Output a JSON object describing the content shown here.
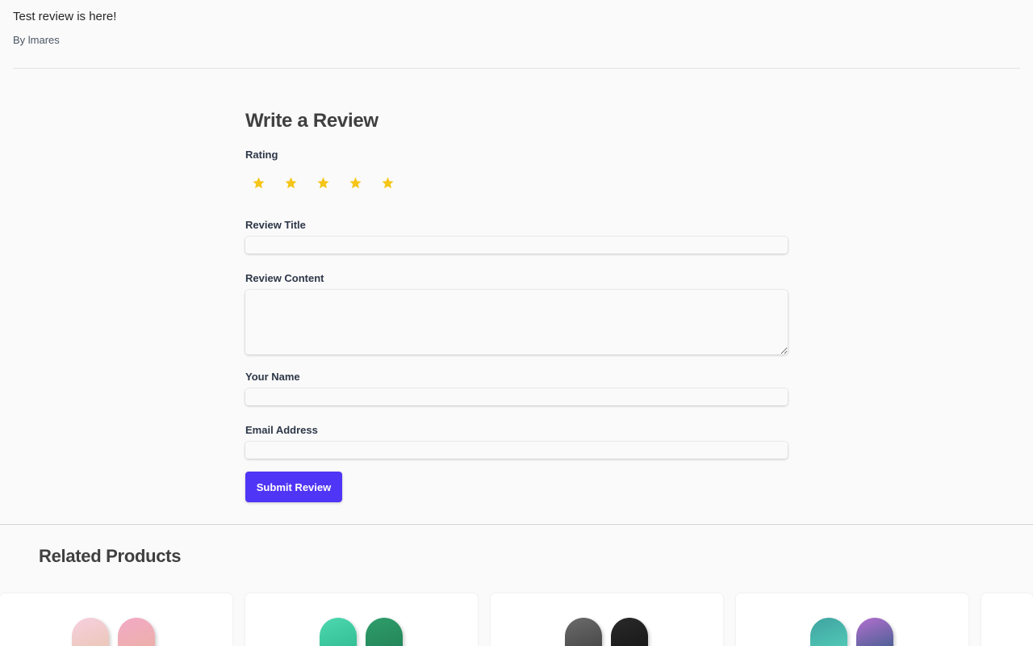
{
  "existing_review": {
    "body": "Test review is here!",
    "author": "By lmares"
  },
  "review_form": {
    "heading": "Write a Review",
    "rating_label": "Rating",
    "rating_value": 5,
    "rating_max": 5,
    "star_color": "#f5c518",
    "fields": {
      "title_label": "Review Title",
      "content_label": "Review Content",
      "name_label": "Your Name",
      "email_label": "Email Address"
    },
    "submit_label": "Submit Review",
    "accent_color": "#4f35f5"
  },
  "related": {
    "heading": "Related Products",
    "products": [
      {
        "front_color": "linear-gradient(160deg,#f6d0df,#e7c3a8)",
        "back_color": "linear-gradient(160deg,#f3a9c6,#e8b39e)"
      },
      {
        "front_color": "linear-gradient(160deg,#4fd8b0,#27b38a)",
        "back_color": "linear-gradient(160deg,#2f9e6b,#1f7a52)"
      },
      {
        "front_color": "linear-gradient(160deg,#6b6b6b,#3a3a3a)",
        "back_color": "linear-gradient(160deg,#2a2a2a,#111111)"
      },
      {
        "front_color": "linear-gradient(160deg,#3fa3a0,#5ad8c0)",
        "back_color": "linear-gradient(160deg,#b46fd0,#1f5a7a)"
      }
    ]
  }
}
